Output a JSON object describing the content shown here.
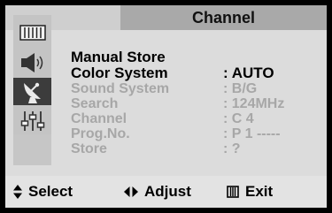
{
  "header": {
    "title": "Channel"
  },
  "sidebar": {
    "items": [
      {
        "icon": "picture-icon"
      },
      {
        "icon": "speaker-icon"
      },
      {
        "icon": "satellite-dish-icon",
        "active": true
      },
      {
        "icon": "settings-sliders-icon"
      }
    ]
  },
  "menu": {
    "heading": "Manual Store",
    "items": [
      {
        "label": "Color System",
        "value": ": AUTO",
        "enabled": true
      },
      {
        "label": "Sound System",
        "value": ": B/G",
        "enabled": false
      },
      {
        "label": "Search",
        "value": ": 124MHz",
        "enabled": false
      },
      {
        "label": "Channel",
        "value": ": C 4",
        "enabled": false
      },
      {
        "label": "Prog.No.",
        "value": ": P 1 -----",
        "enabled": false
      },
      {
        "label": "Store",
        "value": ":  ?",
        "enabled": false
      }
    ]
  },
  "help": {
    "select_label": "Select",
    "adjust_label": "Adjust",
    "exit_label": "Exit",
    "select_icon": "up-down-arrows-icon",
    "adjust_icon": "left-right-arrows-icon",
    "exit_icon": "menu-grid-icon"
  }
}
